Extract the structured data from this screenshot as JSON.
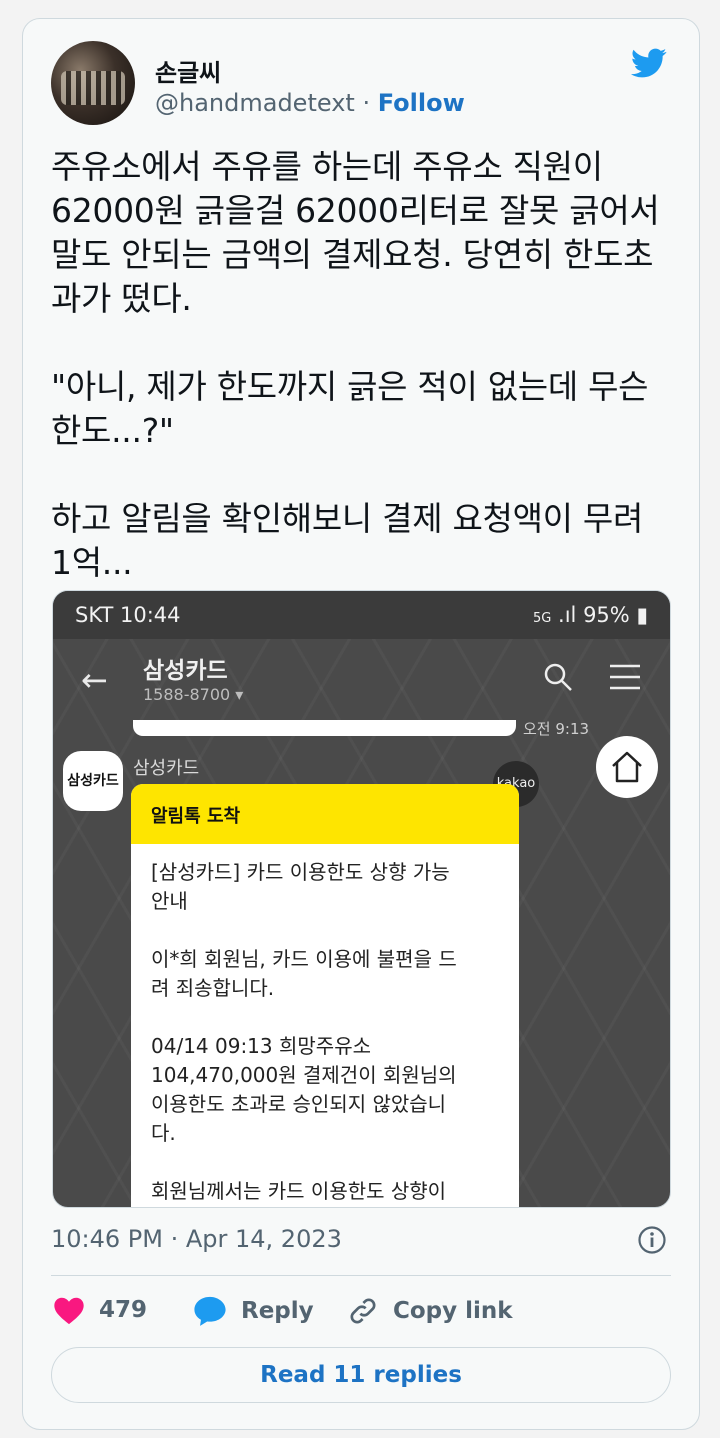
{
  "author": {
    "name": "손글씨",
    "handle": "@handmadetext",
    "separator": " · ",
    "follow_label": "Follow"
  },
  "tweet": {
    "text": "주유소에서 주유를 하는데 주유소 직원이\n62000원 긁을걸 62000리터로 잘못 긁어서\n말도 안되는 금액의 결제요청. 당연히 한도초\n과가 떴다.\n\n\"아니, 제가 한도까지 긁은 적이 없는데 무슨\n한도...?\"\n\n하고 알림을 확인해보니 결제 요청액이 무려\n1억..."
  },
  "media": {
    "status": {
      "carrier_time": "SKT 10:44",
      "battery": "95%",
      "network": "5G"
    },
    "chat": {
      "title": "삼성카드",
      "subtitle": "1588-8700 ▾",
      "time": "오전 9:13",
      "sender": "삼성카드",
      "avatar_label": "삼성카드",
      "kakao_label": "kakao",
      "bubble_header": "알림톡 도착",
      "bubble_body": "[삼성카드] 카드 이용한도 상향 가능\n안내\n\n이*희 회원님, 카드 이용에 불편을 드\n려 죄송합니다.\n\n04/14 09:13 희망주유소\n104,470,000원 결제건이 회원님의\n이용한도 초과로 승인되지 않았습니\n다.\n\n회원님께서는 카드 이용한도 상향이"
    }
  },
  "meta": {
    "timestamp": "10:46 PM · Apr 14, 2023"
  },
  "actions": {
    "likes": "479",
    "reply_label": "Reply",
    "copy_label": "Copy link",
    "read_replies_label": "Read 11 replies"
  },
  "colors": {
    "accent": "#1d73c4",
    "like": "#f91880",
    "bird": "#1d9bf0",
    "kakao_yellow": "#fee500"
  }
}
